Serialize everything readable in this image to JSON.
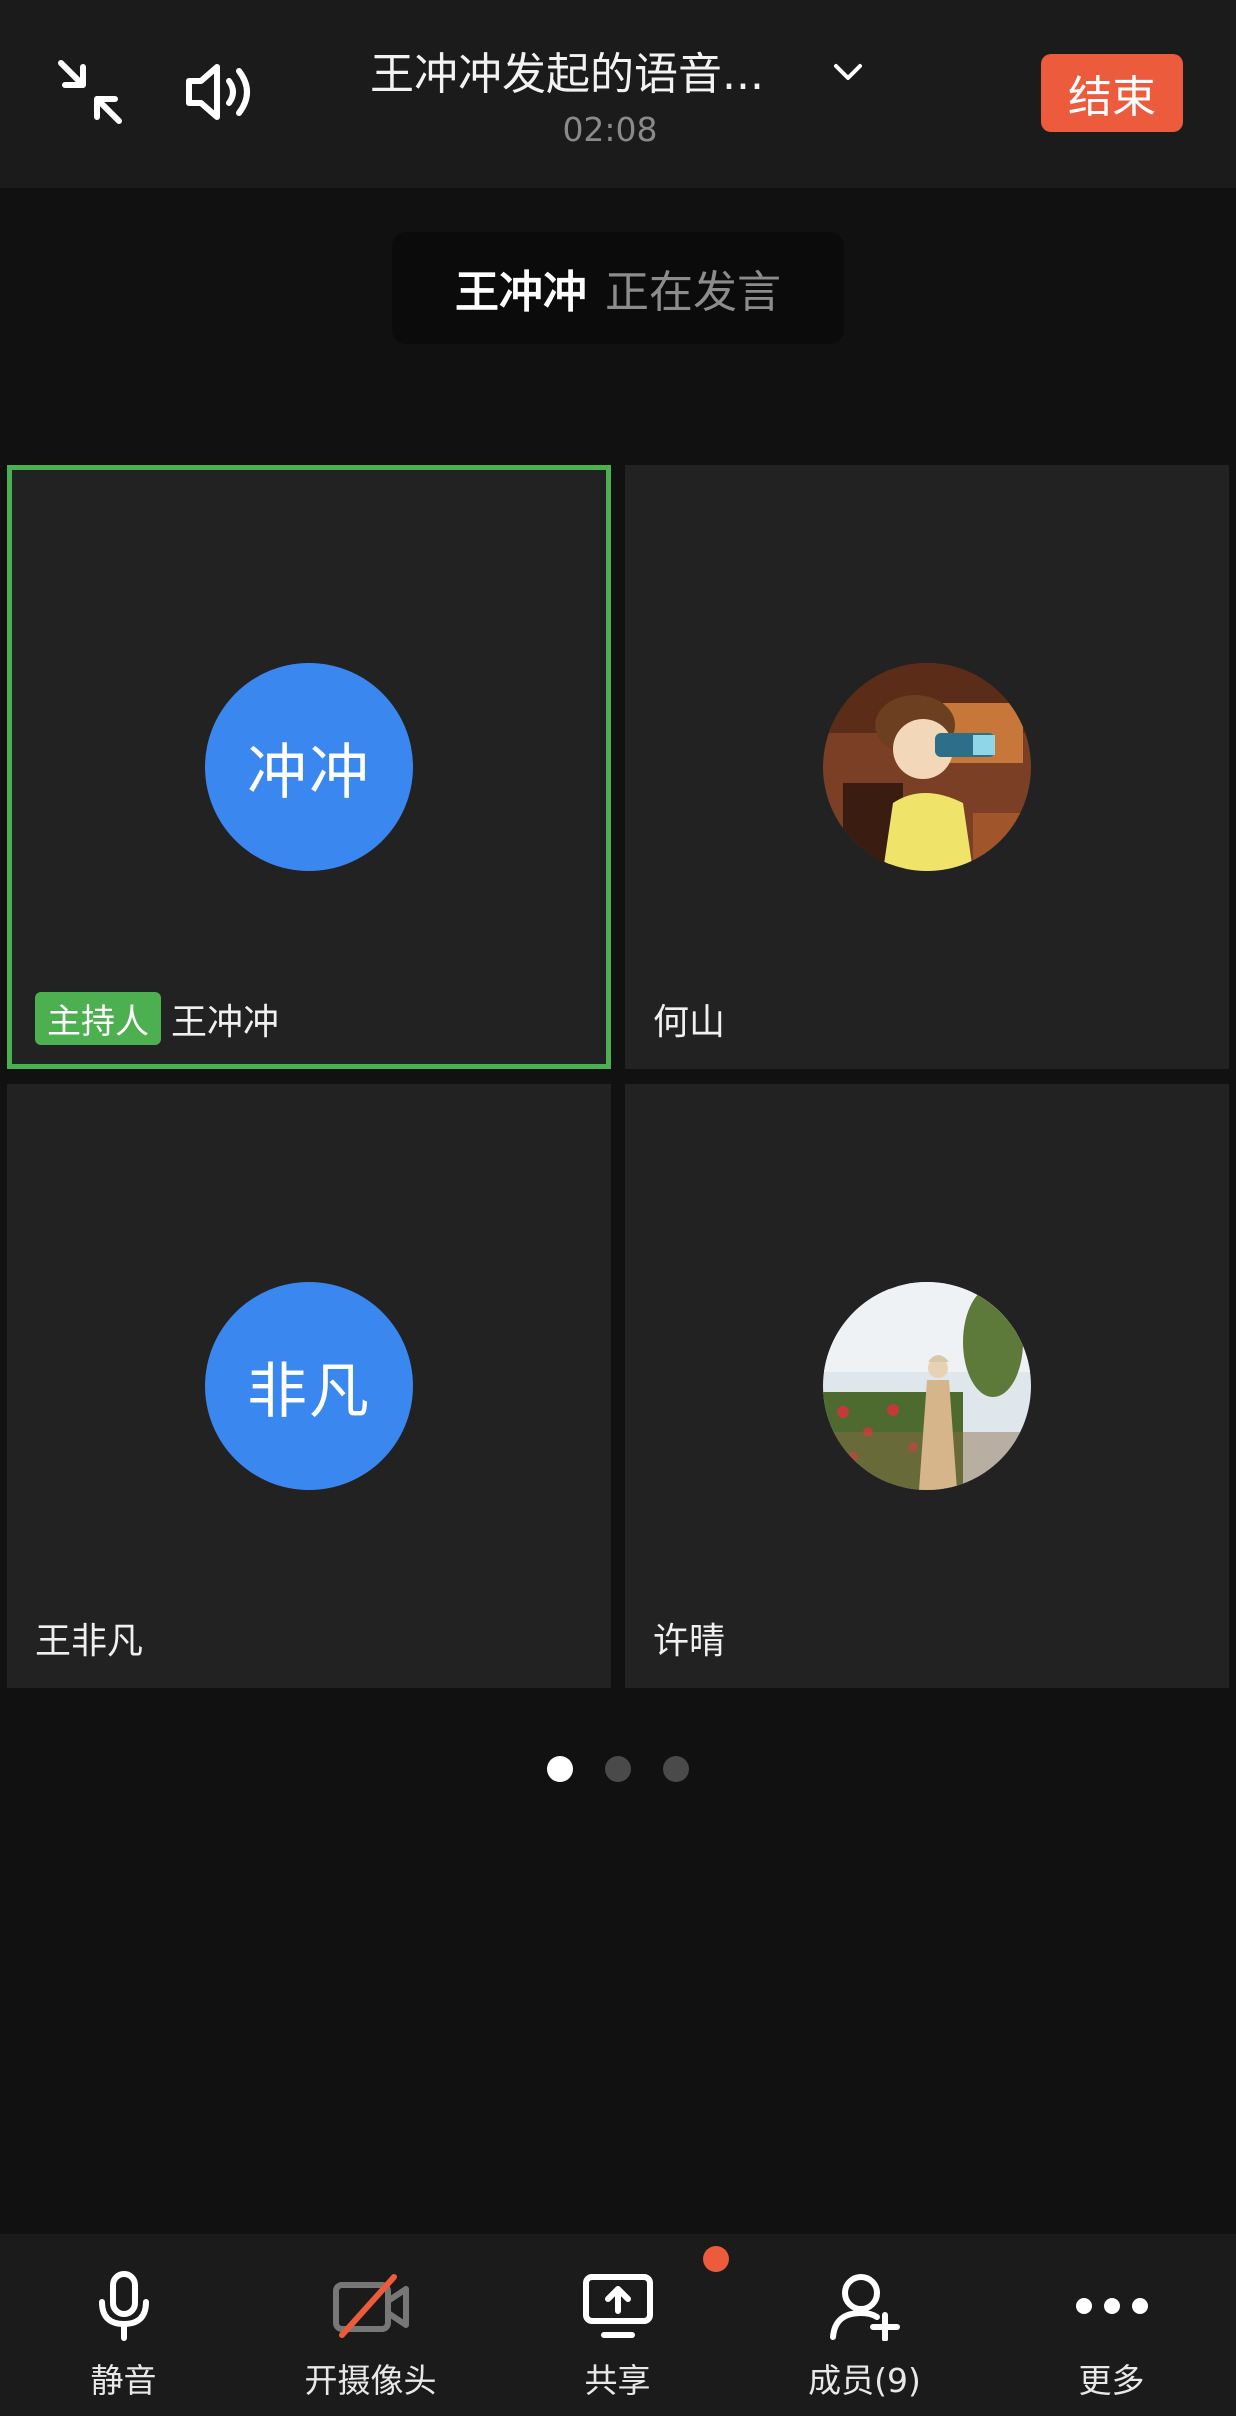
{
  "header": {
    "title": "王冲冲发起的语音...",
    "timer": "02:08",
    "end_label": "结束",
    "icons": [
      "collapse-icon",
      "speaker-icon",
      "chevron-down-icon"
    ]
  },
  "speaking": {
    "name": "王冲冲",
    "status": "正在发言"
  },
  "participants": [
    {
      "avatar_text": "冲冲",
      "name": "王冲冲",
      "badge": "主持人",
      "active": true,
      "avatar_color": "#3a87f0"
    },
    {
      "avatar_image": "cartoon-avatar",
      "name": "何山"
    },
    {
      "avatar_text": "非凡",
      "name": "王非凡",
      "avatar_color": "#3a87f0"
    },
    {
      "avatar_image": "photo-avatar",
      "name": "许晴"
    }
  ],
  "pagination": {
    "current": 1,
    "total": 3
  },
  "toolbar": {
    "mute": "静音",
    "camera": "开摄像头",
    "share": "共享",
    "members": "成员(9)",
    "more": "更多"
  },
  "colors": {
    "accent_end": "#ec5b3b",
    "host_green": "#4caf50",
    "avatar_blue": "#3a87f0"
  }
}
